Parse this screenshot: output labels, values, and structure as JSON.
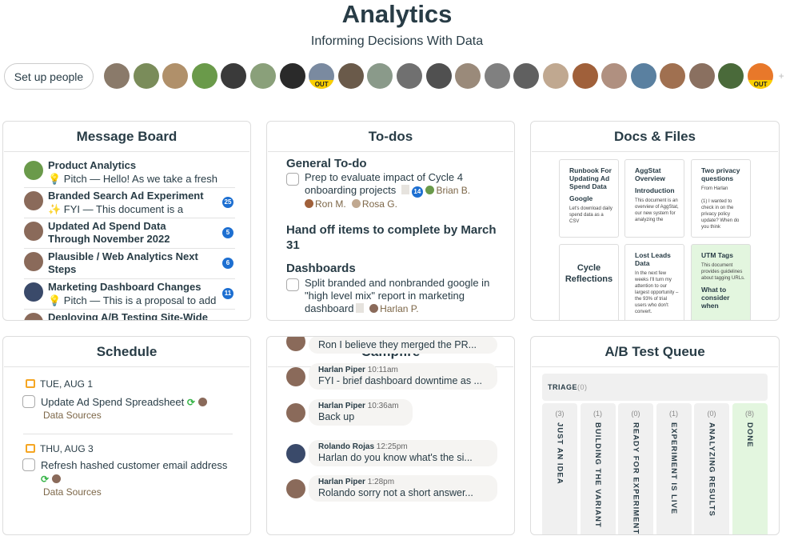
{
  "header": {
    "title": "Analytics",
    "subtitle": "Informing Decisions With Data",
    "setup_label": "Set up people",
    "out_label": "OUT",
    "add_label": "+"
  },
  "people": [
    {
      "color": "#8a7a6a"
    },
    {
      "color": "#7a8c5a"
    },
    {
      "color": "#b0906a"
    },
    {
      "color": "#6a9a4a"
    },
    {
      "color": "#3a3a3a"
    },
    {
      "color": "#8aa07a"
    },
    {
      "color": "#2a2a2a"
    },
    {
      "color": "#7a8aa0",
      "out": true
    },
    {
      "color": "#6a5a4a"
    },
    {
      "color": "#8a9a8a"
    },
    {
      "color": "#707070"
    },
    {
      "color": "#505050"
    },
    {
      "color": "#9a8a7a"
    },
    {
      "color": "#808080"
    },
    {
      "color": "#606060"
    },
    {
      "color": "#c0a890"
    },
    {
      "color": "#a0603a"
    },
    {
      "color": "#b09080"
    },
    {
      "color": "#5a80a0"
    },
    {
      "color": "#a07050"
    },
    {
      "color": "#8a7060"
    },
    {
      "color": "#4a6a3a"
    },
    {
      "color": "#e8782a",
      "out": true
    }
  ],
  "message_board": {
    "title": "Message Board",
    "items": [
      {
        "title": "Product Analytics",
        "snippet": "💡 Pitch — Hello! As we take a fresh",
        "count": "",
        "avatar": "#6a9a4a"
      },
      {
        "title": "Branded Search Ad Experiment",
        "snippet": "✨ FYI — This document is a",
        "count": "25",
        "avatar": "#8a6a5a"
      },
      {
        "title": "Updated Ad Spend Data Through November 2022",
        "snippet": "",
        "count": "5",
        "avatar": "#8a6a5a"
      },
      {
        "title": "Plausible / Web Analytics Next Steps",
        "snippet": "",
        "count": "6",
        "avatar": "#8a6a5a"
      },
      {
        "title": "Marketing Dashboard Changes",
        "snippet": "💡 Pitch — This is a proposal to add",
        "count": "11",
        "avatar": "#3a4a6a"
      },
      {
        "title": "Deploying A/B Testing Site-Wide",
        "snippet": "",
        "count": "",
        "avatar": "#8a6a5a"
      }
    ]
  },
  "todos": {
    "title": "To-dos",
    "lists": [
      {
        "name": "General To-do",
        "items": [
          {
            "text": "Prep to evaluate impact of Cycle 4 onboarding projects",
            "count": "14",
            "assignees": [
              "Brian B.",
              "Ron M.",
              "Rosa G."
            ]
          }
        ]
      },
      {
        "name": "Hand off items to complete by March 31"
      },
      {
        "name": "Dashboards",
        "items": [
          {
            "text": "Split branded and nonbranded google in \"high level mix\" report in marketing dashboard",
            "assignees": [
              "Harlan P."
            ]
          }
        ]
      }
    ]
  },
  "docs": {
    "title": "Docs & Files",
    "items": [
      {
        "title": "Runbook For Updating Ad Spend Data",
        "heading": "Google",
        "body": "Let's download daily spend data as a CSV"
      },
      {
        "title": "AggStat Overview",
        "heading": "Introduction",
        "body": "This document is an overview of AggStat, our new system for analyzing the"
      },
      {
        "title": "Two privacy questions",
        "heading": "",
        "body": "From Harlan\n\n(1) I wanted to check in on the privacy policy update? When do you think"
      },
      {
        "title": "Cycle Reflections",
        "heading": "",
        "body": ""
      },
      {
        "title": "Lost Leads Data",
        "heading": "",
        "body": "In the next few weeks I'll turn my attention to our largest opportunity – the 93% of trial users who don't convert."
      },
      {
        "title": "UTM Tags",
        "heading": "What to consider when",
        "body": "This document provides guidelines about tagging URLs."
      }
    ]
  },
  "schedule": {
    "title": "Schedule",
    "days": [
      {
        "date": "TUE, AUG 1",
        "task": "Update Ad Spend Spreadsheet",
        "project": "Data Sources"
      },
      {
        "date": "THU, AUG 3",
        "task": "Refresh hashed customer email address",
        "project": "Data Sources"
      }
    ]
  },
  "campfire": {
    "title": "Campfire",
    "messages": [
      {
        "author": "",
        "time": "",
        "text": "Ron I believe they merged the PR...",
        "avatar": "#8a6a5a"
      },
      {
        "author": "Harlan Piper",
        "time": "10:11am",
        "text": "FYI - brief dashboard downtime as ...",
        "avatar": "#8a6a5a"
      },
      {
        "author": "Harlan Piper",
        "time": "10:36am",
        "text": "Back up",
        "avatar": "#8a6a5a"
      },
      {
        "author": "Rolando Rojas",
        "time": "12:25pm",
        "text": "Harlan do you know what's the si...",
        "avatar": "#3a4a6a"
      },
      {
        "author": "Harlan Piper",
        "time": "1:28pm",
        "text": "Rolando sorry not a short answer...",
        "avatar": "#8a6a5a"
      }
    ]
  },
  "ab_queue": {
    "title": "A/B Test Queue",
    "triage": {
      "label": "TRIAGE",
      "count": "(0)"
    },
    "columns": [
      {
        "label": "JUST AN IDEA",
        "count": "(3)"
      },
      {
        "label": "BUILDING THE VARIANT",
        "count": "(1)"
      },
      {
        "label": "READY FOR EXPERIMENT",
        "count": "(0)"
      },
      {
        "label": "EXPERIMENT IS LIVE",
        "count": "(1)"
      },
      {
        "label": "ANALYZING RESULTS",
        "count": "(0)"
      },
      {
        "label": "DONE",
        "count": "(8)"
      }
    ]
  },
  "colors": {
    "accent_blue": "#1d6fd1",
    "done_green": "#e3f6df",
    "schedule_orange": "#f5a623",
    "text": "#283c46"
  }
}
